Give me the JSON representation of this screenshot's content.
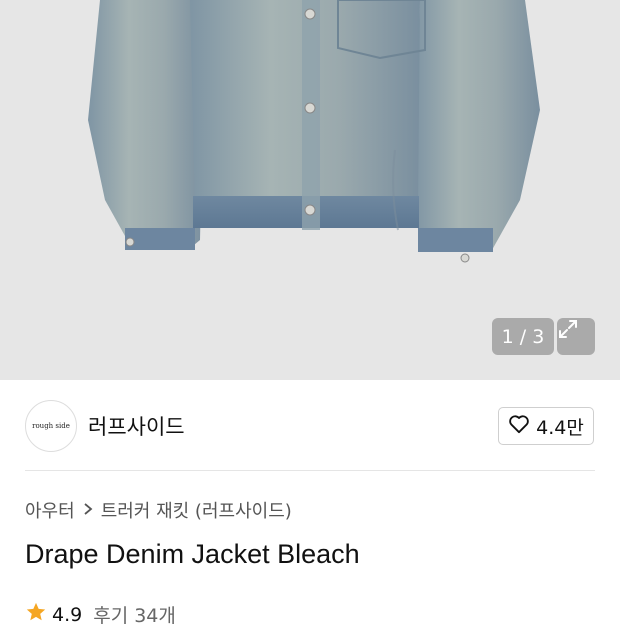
{
  "gallery": {
    "counter_text": "1 / 3",
    "image_subject": "denim jacket photo"
  },
  "brand": {
    "logo_text": "rough side",
    "name": "러프사이드",
    "like_count": "4.4만"
  },
  "breadcrumb": {
    "category": "아우터",
    "subcategory": "트러커 재킷 (러프사이드)"
  },
  "product": {
    "title": "Drape Denim Jacket Bleach"
  },
  "rating": {
    "score": "4.9",
    "reviews": "후기 34개"
  },
  "colors": {
    "star": "#f5a623",
    "denim": "#8ea0ad"
  },
  "icons": [
    "expand-icon",
    "heart-icon",
    "chevron-right-icon",
    "star-icon"
  ]
}
